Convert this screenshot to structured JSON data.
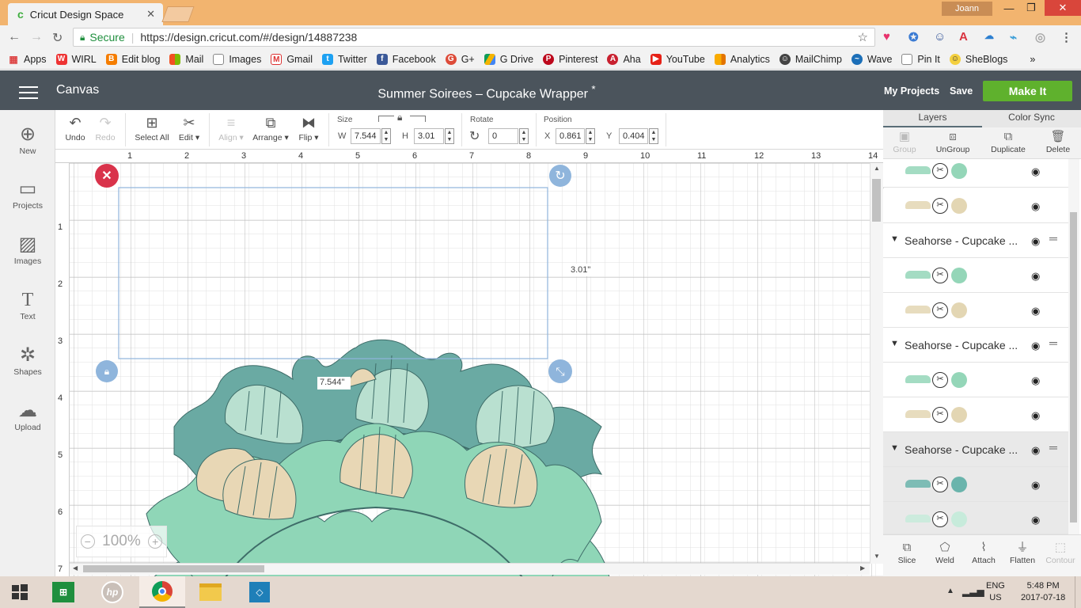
{
  "browser": {
    "tab_title": "Cricut Design Space",
    "user": "Joann",
    "secure_label": "Secure",
    "url": "https://design.cricut.com/#/design/14887238",
    "bookmarks": [
      "Apps",
      "WIRL",
      "Edit blog",
      "Mail",
      "Images",
      "Gmail",
      "Twitter",
      "Facebook",
      "G+",
      "G Drive",
      "Pinterest",
      "Aha",
      "YouTube",
      "Analytics",
      "MailChimp",
      "Wave",
      "Pin It",
      "SheBlogs"
    ]
  },
  "header": {
    "canvas_label": "Canvas",
    "project_title": "Summer Soirees – Cupcake Wrapper",
    "unsaved_marker": "*",
    "my_projects": "My Projects",
    "save": "Save",
    "make_it": "Make It"
  },
  "left_toolbar": {
    "new": "New",
    "projects": "Projects",
    "images": "Images",
    "text": "Text",
    "shapes": "Shapes",
    "upload": "Upload"
  },
  "edit_toolbar": {
    "undo": "Undo",
    "redo": "Redo",
    "select_all": "Select All",
    "edit": "Edit",
    "align": "Align",
    "arrange": "Arrange",
    "flip": "Flip",
    "size_label": "Size",
    "w_label": "W",
    "w_value": "7.544",
    "h_label": "H",
    "h_value": "3.01",
    "rotate_label": "Rotate",
    "rotate_value": "0",
    "position_label": "Position",
    "x_label": "X",
    "x_value": "0.861",
    "y_label": "Y",
    "y_value": "0.404"
  },
  "canvas": {
    "h_ruler": [
      "1",
      "2",
      "3",
      "4",
      "5",
      "6",
      "7",
      "8",
      "9",
      "10",
      "11",
      "12",
      "13",
      "14"
    ],
    "v_ruler": [
      "1",
      "2",
      "3",
      "4",
      "5",
      "6",
      "7"
    ],
    "height_readout": "3.01\"",
    "width_readout": "7.544\"",
    "zoom": "100%",
    "zoom_out": "−",
    "zoom_in": "+",
    "colors": {
      "teal_dark": "#6aaaa3",
      "teal_light": "#b9e0d0",
      "mint": "#8fd6b7",
      "tan": "#e8d7b5",
      "selection": "#8fb5dc",
      "delete_red": "#d9334b"
    }
  },
  "layers_panel": {
    "tab_layers": "Layers",
    "tab_color_sync": "Color Sync",
    "tools": [
      "Group",
      "UnGroup",
      "Duplicate",
      "Delete"
    ],
    "groups": [
      {
        "name": "Seahorse - Cupcake ..."
      },
      {
        "name": "Seahorse - Cupcake ..."
      },
      {
        "name": "Seahorse - Cupcake ..."
      }
    ],
    "layer_colors": [
      "#94d6b8",
      "#e3d6b3",
      "#94d6b8",
      "#e3d6b3",
      "#94d6b8",
      "#e3d6b3",
      "#6ab4ac",
      "#c7ebdb"
    ],
    "bottom_tools": [
      "Slice",
      "Weld",
      "Attach",
      "Flatten",
      "Contour"
    ]
  },
  "taskbar": {
    "lang_top": "ENG",
    "lang_bottom": "US",
    "time": "5:48 PM",
    "date": "2017-07-18"
  }
}
